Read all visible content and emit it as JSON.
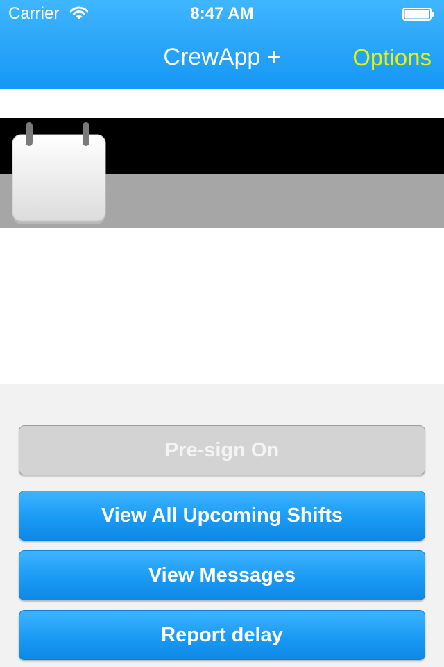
{
  "status_bar": {
    "carrier": "Carrier",
    "time": "8:47 AM"
  },
  "nav": {
    "title": "CrewApp +",
    "options": "Options"
  },
  "actions": {
    "presign_on": "Pre-sign On",
    "view_shifts": "View All Upcoming Shifts",
    "view_messages": "View Messages",
    "report_delay": "Report delay"
  },
  "colors": {
    "nav_blue": "#1a9cf6",
    "options_yellow": "#e6f20a",
    "button_blue": "#1798f3",
    "disabled_gray": "#d3d3d3"
  },
  "icons": [
    "wifi-icon",
    "battery-icon",
    "calendar-icon"
  ]
}
